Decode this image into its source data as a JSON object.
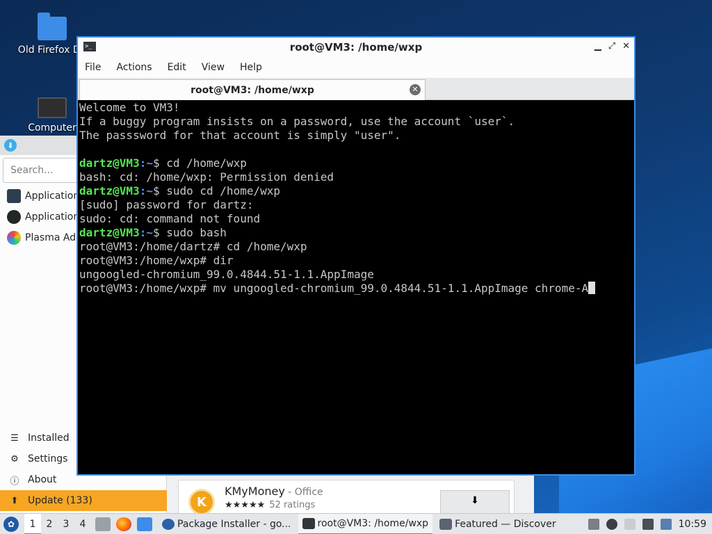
{
  "desktop": {
    "icons": [
      {
        "label": "Old Firefox Da",
        "icon": "folder-icon"
      },
      {
        "label": "Computer",
        "icon": "computer-icon"
      }
    ]
  },
  "discover": {
    "search_placeholder": "Search...",
    "categories": [
      {
        "label": "Application"
      },
      {
        "label": "Application"
      },
      {
        "label": "Plasma Add"
      }
    ],
    "nav": {
      "installed": "Installed",
      "settings": "Settings",
      "about": "About",
      "update": "Update (133)"
    },
    "card": {
      "name": "KMyMoney",
      "category": " - Office",
      "stars": "★★★★★",
      "ratings": "52 ratings",
      "install_glyph": "⬇"
    }
  },
  "terminal": {
    "window_title": "root@VM3: /home/wxp",
    "tab_title": "root@VM3: /home/wxp",
    "menu": [
      "File",
      "Actions",
      "Edit",
      "View",
      "Help"
    ],
    "lines": {
      "l1": "Welcome to VM3!",
      "l2": "If a buggy program insists on a password, use the account `user`.",
      "l3": "The passsword for that account is simply \"user\".",
      "user": "dartz@VM3",
      "path": ":~",
      "c1": "$ cd /home/wxp",
      "o1": "bash: cd: /home/wxp: Permission denied",
      "c2": "$ sudo cd /home/wxp",
      "o2": "[sudo] password for dartz:",
      "o3": "sudo: cd: command not found",
      "c3": "$ sudo bash",
      "o4": "root@VM3:/home/dartz# cd /home/wxp",
      "o5": "root@VM3:/home/wxp# dir",
      "o6": "ungoogled-chromium_99.0.4844.51-1.1.AppImage",
      "o7": "root@VM3:/home/wxp# mv ungoogled-chromium_99.0.4844.51-1.1.AppImage chrome-A"
    }
  },
  "taskbar": {
    "desktops": [
      "1",
      "2",
      "3",
      "4"
    ],
    "tasks": [
      {
        "label": "Package Installer - go...",
        "icon": "package-installer-icon"
      },
      {
        "label": "root@VM3: /home/wxp",
        "icon": "terminal-icon"
      },
      {
        "label": "Featured — Discover",
        "icon": "discover-icon"
      }
    ],
    "clock": "10:59"
  }
}
